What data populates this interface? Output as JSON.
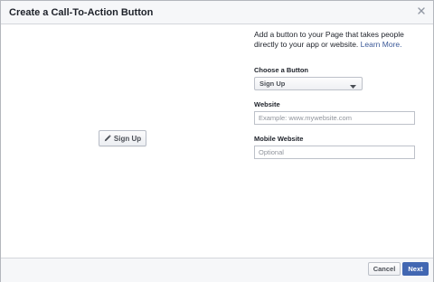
{
  "dialog": {
    "title": "Create a Call-To-Action Button",
    "close_icon": "close-icon"
  },
  "preview": {
    "button_label": "Sign Up",
    "button_icon": "pencil-icon"
  },
  "form": {
    "description": "Add a button to your Page that takes people directly to your app or website.",
    "learn_more": "Learn More.",
    "choose_label": "Choose a Button",
    "choose_value": "Sign Up",
    "website_label": "Website",
    "website_placeholder": "Example: www.mywebsite.com",
    "website_value": "",
    "mobile_label": "Mobile Website",
    "mobile_placeholder": "Optional",
    "mobile_value": ""
  },
  "footer": {
    "cancel_label": "Cancel",
    "next_label": "Next"
  },
  "colors": {
    "accent": "#4267b2",
    "link": "#3b5998"
  }
}
